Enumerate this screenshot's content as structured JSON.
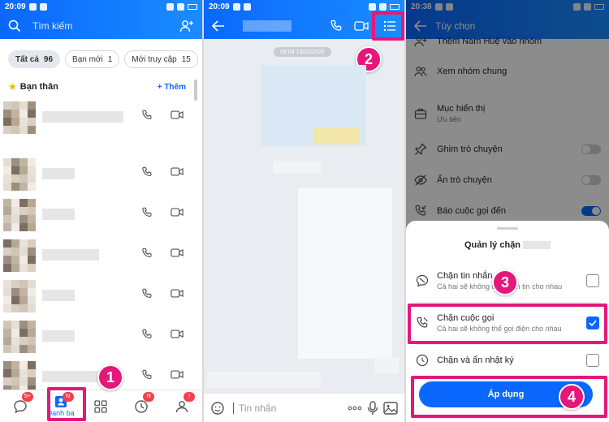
{
  "panel1": {
    "status": {
      "time": "20:09"
    },
    "search": {
      "placeholder": "Tìm kiếm"
    },
    "chips": [
      {
        "label": "Tất cả",
        "count": "96"
      },
      {
        "label": "Bạn mới",
        "count": "1"
      },
      {
        "label": "Mới truy cập",
        "count": "15"
      }
    ],
    "section": {
      "title": "Bạn thân",
      "add_label": "+ Thêm"
    },
    "nav": {
      "messages_badge": "5+",
      "contacts_label": "Danh bạ",
      "contacts_badge": "N",
      "timeline_badge": "N",
      "me_badge": "!"
    },
    "step": "1"
  },
  "panel2": {
    "status": {
      "time": "20:09"
    },
    "date_stamp": "09:04 13/02/2020",
    "input_placeholder": "Tin nhắn",
    "step": "2"
  },
  "panel3": {
    "status": {
      "time": "20:38"
    },
    "header_title": "Tùy chọn",
    "options": [
      {
        "label": "Thêm Nam Huệ vào nhóm",
        "sub": ""
      },
      {
        "label": "Xem nhóm chung",
        "sub": ""
      },
      {
        "label": "Mục hiển thị",
        "sub": "Ưu tiên"
      },
      {
        "label": "Ghim trò chuyện",
        "sub": ""
      },
      {
        "label": "Ẩn trò chuyện",
        "sub": ""
      },
      {
        "label": "Báo cuộc gọi đến",
        "sub": ""
      }
    ],
    "sheet": {
      "title": "Quản lý chặn",
      "items": [
        {
          "label": "Chặn tin nhắn",
          "sub": "Cả hai sẽ không thể nhắn tin cho nhau",
          "checked": false
        },
        {
          "label": "Chặn cuộc gọi",
          "sub": "Cả hai sẽ không thể gọi điện cho nhau",
          "checked": true
        },
        {
          "label": "Chặn và ẩn nhật ký",
          "sub": "",
          "checked": false
        }
      ],
      "apply_label": "Áp dụng"
    },
    "steps": [
      "3",
      "4"
    ]
  },
  "colors": {
    "brand_blue": "#0a68ff",
    "highlight_pink": "#e5177b",
    "badge_red": "#f2414e"
  }
}
